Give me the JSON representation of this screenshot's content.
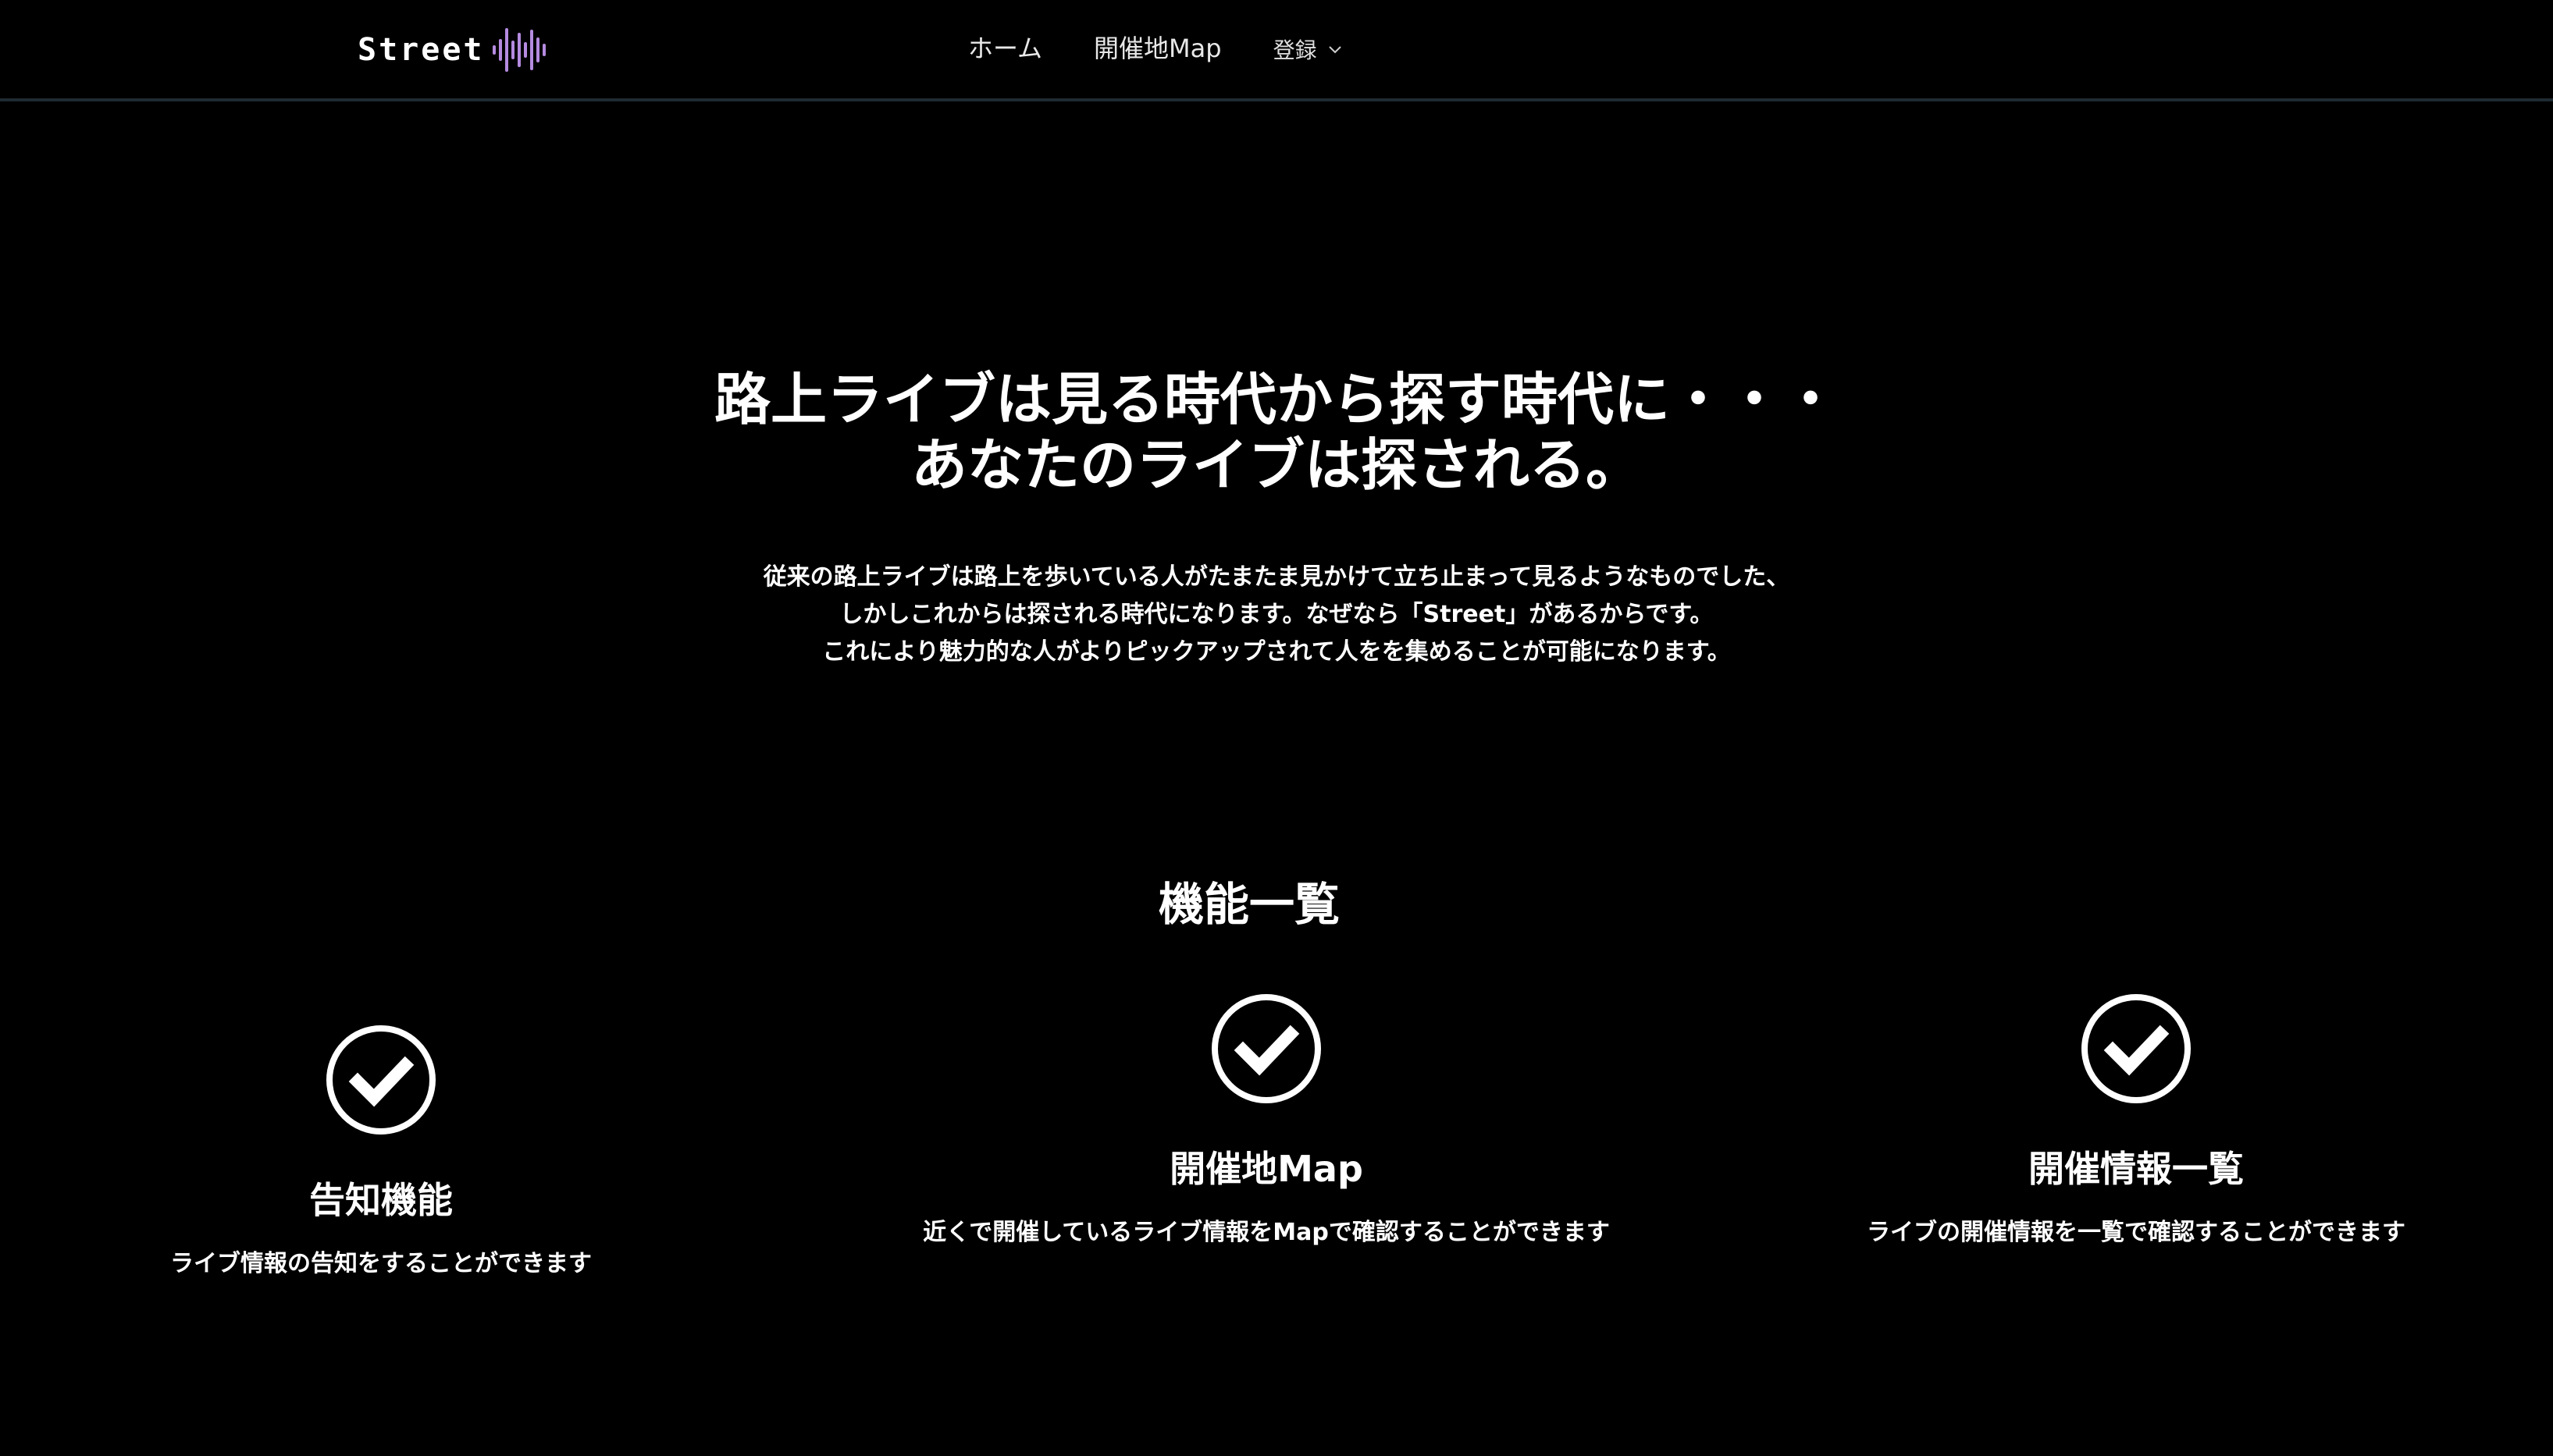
{
  "nav": {
    "brand": "Street",
    "links": [
      {
        "label": "ホーム"
      },
      {
        "label": "開催地Map"
      }
    ],
    "dropdown_label": "登録"
  },
  "hero": {
    "title_line1": "路上ライブは見る時代から探す時代に・・・",
    "title_line2": "あなたのライブは探される。",
    "desc_line1": "従来の路上ライブは路上を歩いている人がたまたま見かけて立ち止まって見るようなものでした、",
    "desc_line2": "しかしこれからは探される時代になります。なぜなら「Street」があるからです。",
    "desc_line3": "これにより魅力的な人がよりピックアップされて人をを集めることが可能になります。"
  },
  "features": {
    "section_title": "機能一覧",
    "items": [
      {
        "icon": "check-circle-icon",
        "title": "告知機能",
        "desc": "ライブ情報の告知をすることができます"
      },
      {
        "icon": "check-circle-icon",
        "title": "開催地Map",
        "desc": "近くで開催しているライブ情報をMapで確認することができます"
      },
      {
        "icon": "check-circle-icon",
        "title": "開催情報一覧",
        "desc": "ライブの開催情報を一覧で確認することができます"
      }
    ]
  },
  "colors": {
    "background": "#000000",
    "text": "#ffffff",
    "brand_accent": "#b58be0",
    "nav_border": "#1f2b33"
  }
}
